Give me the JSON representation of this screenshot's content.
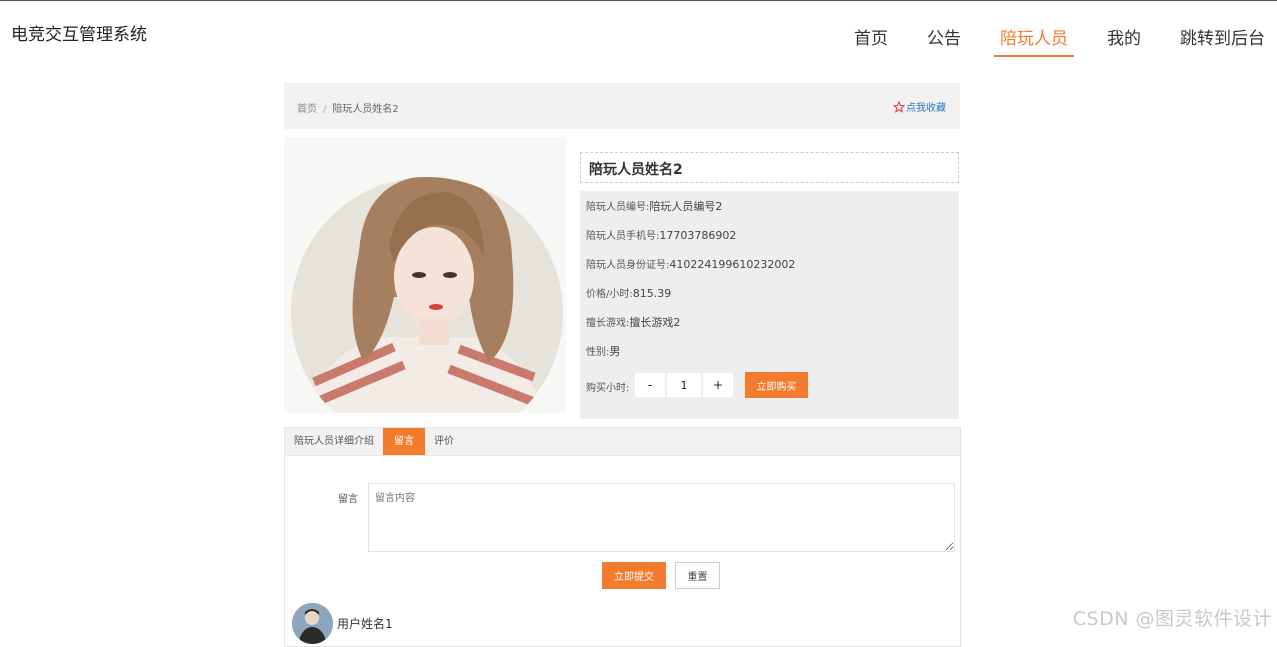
{
  "brand": "电竞交互管理系统",
  "nav": [
    "首页",
    "公告",
    "陪玩人员",
    "我的",
    "跳转到后台"
  ],
  "nav_active_index": 2,
  "breadcrumb": {
    "home": "首页",
    "separator": "/",
    "current": "陪玩人员姓名2"
  },
  "favorite_label": "点我收藏",
  "detail": {
    "name": "陪玩人员姓名2",
    "fields": [
      {
        "label": "陪玩人员编号:",
        "value": "陪玩人员编号2"
      },
      {
        "label": "陪玩人员手机号:",
        "value": "17703786902"
      },
      {
        "label": "陪玩人员身份证号:",
        "value": "410224199610232002"
      },
      {
        "label": "价格/小时:",
        "value": "815.39"
      },
      {
        "label": "擅长游戏:",
        "value": "擅长游戏2"
      },
      {
        "label": "性别:",
        "value": "男"
      }
    ],
    "quantity_label": "购买小时:",
    "minus": "-",
    "quantity": "1",
    "plus": "+",
    "buy_label": "立即购买"
  },
  "tabs": [
    {
      "label": "陪玩人员详细介绍",
      "active": false
    },
    {
      "label": "留言",
      "active": true
    },
    {
      "label": "评价",
      "active": false
    }
  ],
  "message": {
    "label": "留言",
    "placeholder": "留言内容",
    "submit": "立即提交",
    "reset": "重置"
  },
  "comment_user": "用户姓名1",
  "watermark": "CSDN @图灵软件设计",
  "colors": {
    "accent": "#f37b2d",
    "link": "#2c77c9",
    "star": "#e4393c"
  }
}
